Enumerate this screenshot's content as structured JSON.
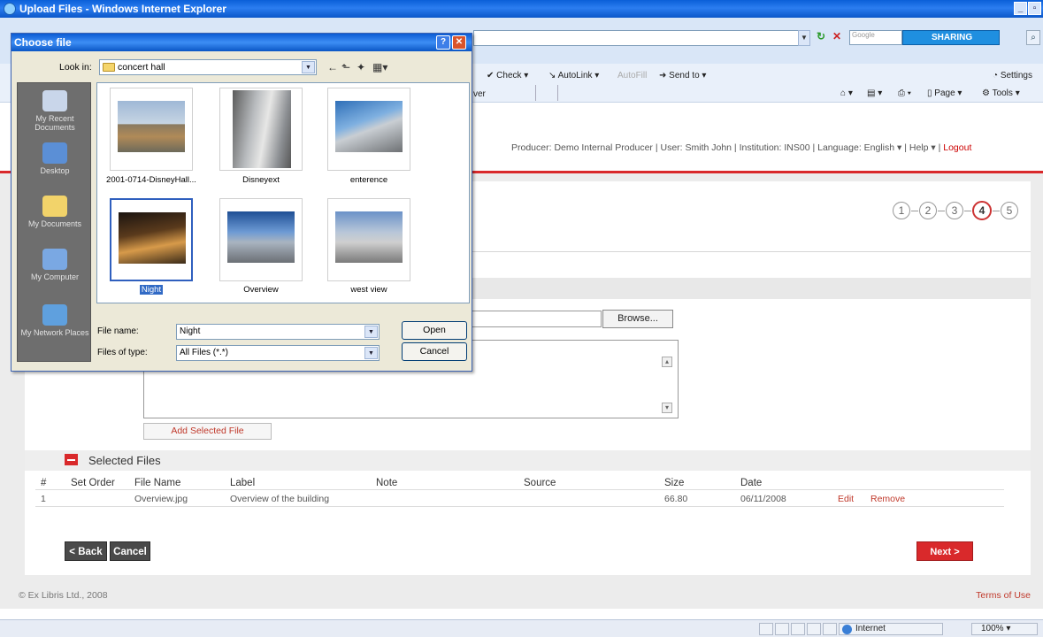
{
  "window": {
    "title": "Upload Files - Windows Internet Explorer"
  },
  "browser_toolbar": {
    "search_placeholder": "Google",
    "sharing_label": "SHARING",
    "check_label": "Check",
    "autolink_label": "AutoLink",
    "autofill_label": "AutoFill",
    "sendto_label": "Send to",
    "settings_label": "Settings",
    "tab_fragment": "ver",
    "page_label": "Page",
    "tools_label": "Tools"
  },
  "userbar": {
    "producer": "Producer: Demo Internal Producer",
    "user": "User: Smith John",
    "institution": "Institution: INS00",
    "language": "Language: English",
    "help": "Help",
    "logout": "Logout"
  },
  "steps": [
    "1",
    "2",
    "3",
    "4",
    "5"
  ],
  "current_step": "4",
  "form": {
    "browse_label": "Browse...",
    "add_selected_label": "Add Selected File"
  },
  "selected_files": {
    "title": "Selected Files",
    "columns": [
      "#",
      "Set Order",
      "File Name",
      "Label",
      "Note",
      "Source",
      "Size",
      "Date"
    ],
    "rows": [
      {
        "num": "1",
        "set_order": "",
        "file_name": "Overview.jpg",
        "label": "Overview of the building",
        "note": "",
        "source": "",
        "size": "66.80",
        "date": "06/11/2008",
        "edit": "Edit",
        "remove": "Remove"
      }
    ]
  },
  "nav": {
    "back": "< Back",
    "cancel": "Cancel",
    "next": "Next >"
  },
  "footer": {
    "copyright": "© Ex Libris Ltd., 2008",
    "terms": "Terms of Use"
  },
  "statusbar": {
    "zone": "Internet",
    "zoom": "100%"
  },
  "dialog": {
    "title": "Choose file",
    "look_in_label": "Look in:",
    "look_in_value": "concert hall",
    "places": [
      "My Recent Documents",
      "Desktop",
      "My Documents",
      "My Computer",
      "My Network Places"
    ],
    "files": [
      {
        "name": "2001-0714-DisneyHall...",
        "selected": false
      },
      {
        "name": "Disneyext",
        "selected": false
      },
      {
        "name": "enterence",
        "selected": false
      },
      {
        "name": "Night",
        "selected": true
      },
      {
        "name": "Overview",
        "selected": false
      },
      {
        "name": "west view",
        "selected": false
      }
    ],
    "file_name_label": "File name:",
    "file_name_value": "Night",
    "file_type_label": "Files of type:",
    "file_type_value": "All Files (*.*)",
    "open_label": "Open",
    "cancel_label": "Cancel"
  }
}
